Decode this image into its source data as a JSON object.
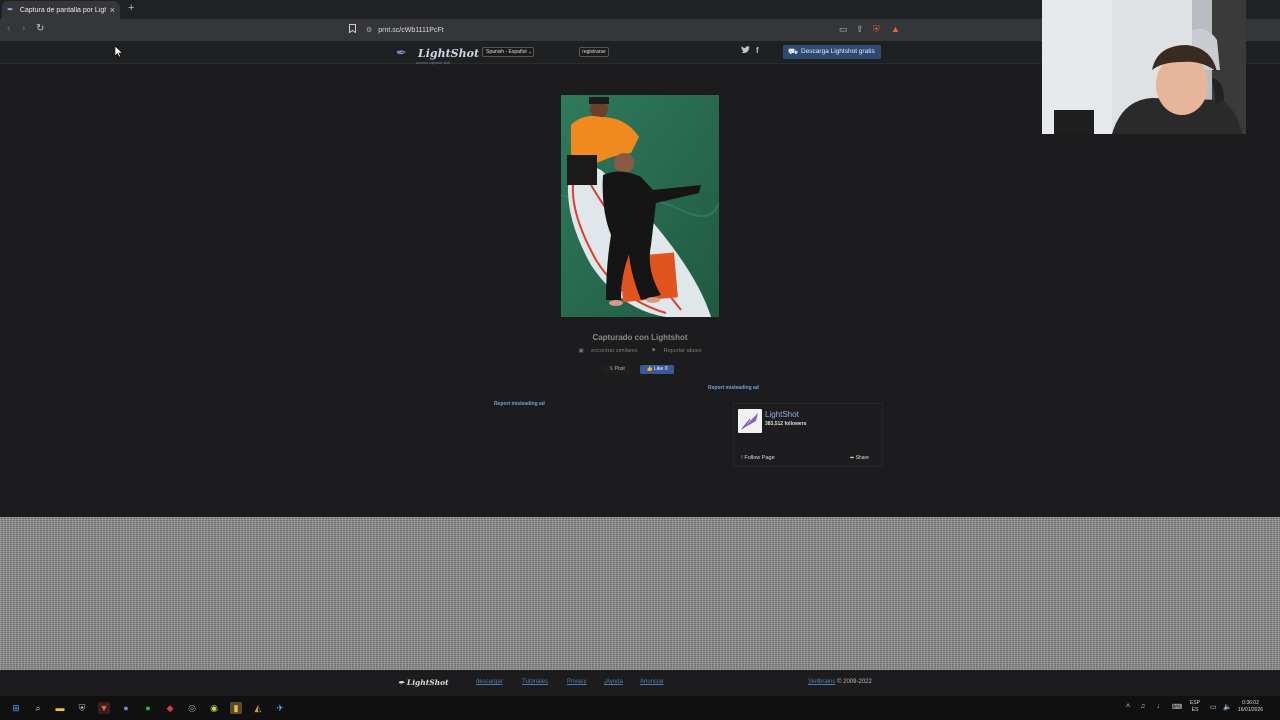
{
  "browser": {
    "tab_title": "Captura de pantalla por Lightsh",
    "tab_close": "×",
    "new_tab": "+",
    "url": "prnt.sc/cWb1111PcFt"
  },
  "site": {
    "logo_name": "LightShot",
    "logo_tagline": "screen capture tool",
    "language": "Spanish - Español",
    "register": "registrarse",
    "download_button": "Descarga Lightshot gratis"
  },
  "capture": {
    "captured_with": "Capturado con Lightshot",
    "find_similar": "encontrar similares",
    "report_abuse": "Reportar abuso",
    "post": "Post",
    "like": "Like 0"
  },
  "ads": {
    "report_misleading_right": "Report misleading ad",
    "report_misleading_left": "Report misleading ad"
  },
  "fb_widget": {
    "page_name": "LightShot",
    "followers": "383,512 followers",
    "follow": "Follow Page",
    "share": "Share"
  },
  "footer": {
    "logo": "LightShot",
    "links": [
      "descargar",
      "Tutoriales",
      "Privacy",
      "¡Ayuda",
      "Anunciar"
    ],
    "copyright_link": "Skillbrains",
    "copyright_text": "© 2009-2022"
  },
  "taskbar": {
    "lang_top": "ESP",
    "lang_bottom": "ES",
    "time": "0:36:02",
    "date": "16/01/2026"
  }
}
